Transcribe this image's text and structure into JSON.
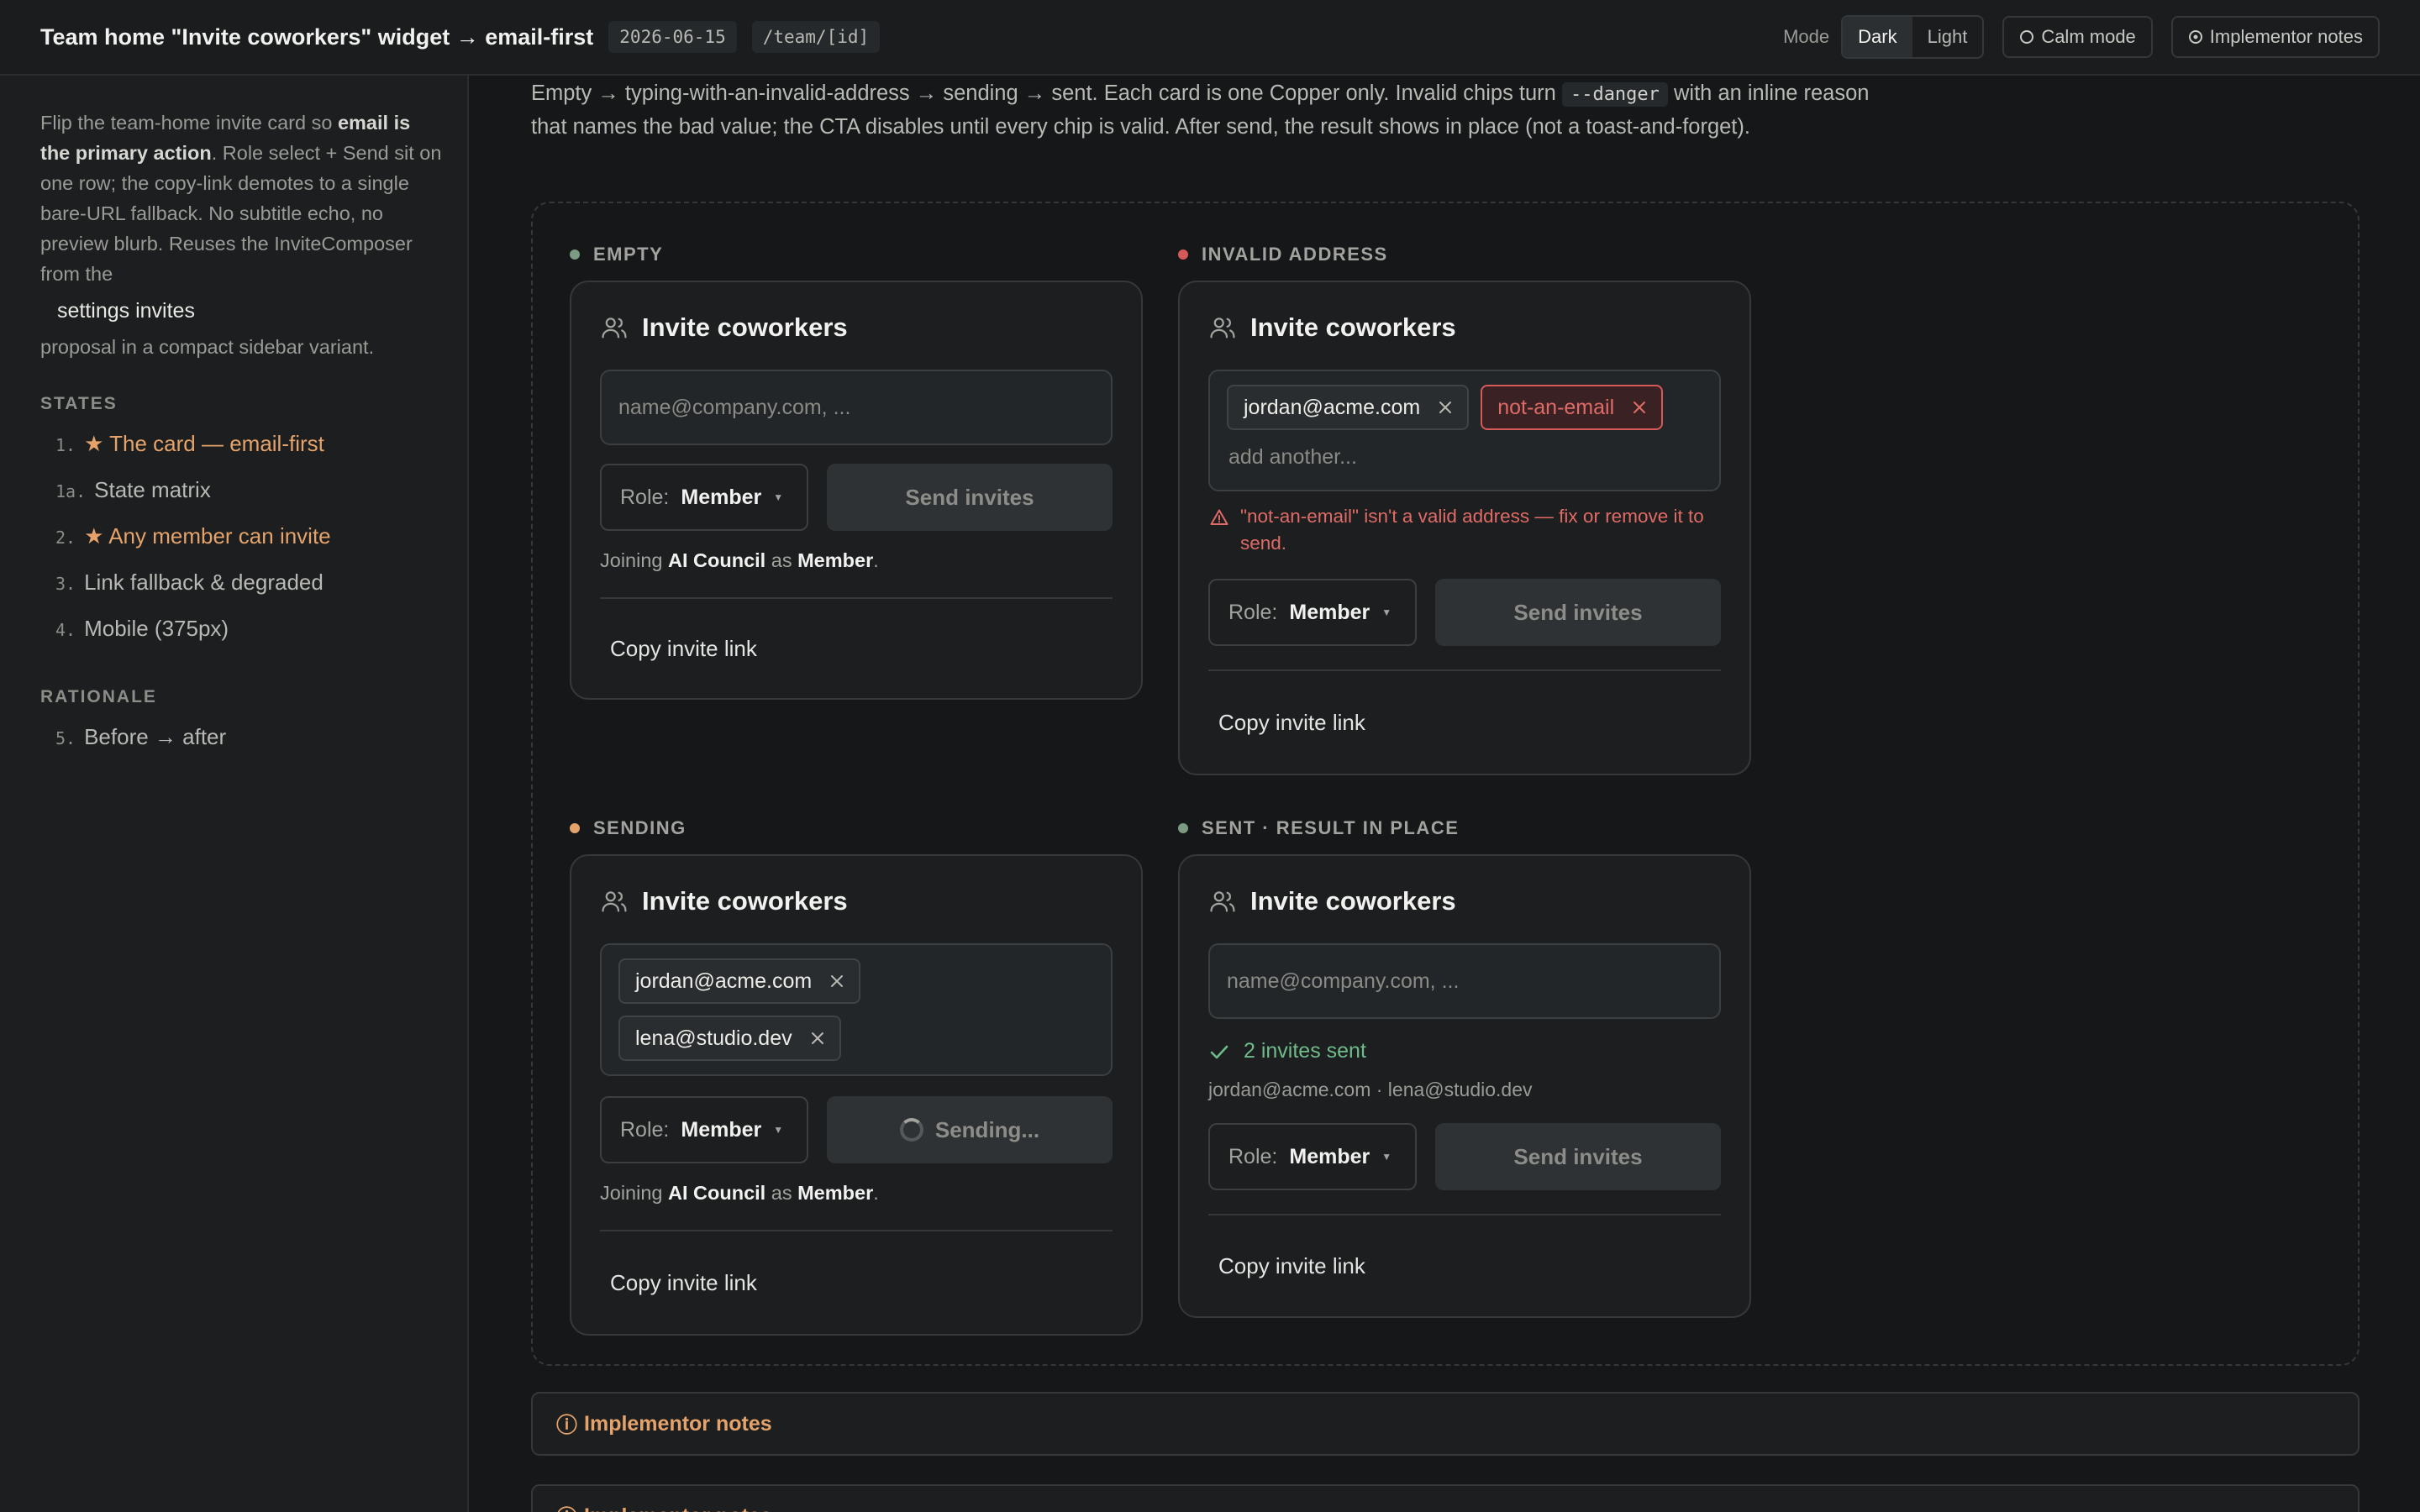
{
  "topbar": {
    "title": "Team home \"Invite coworkers\" widget → email-first",
    "date": "2026-06-15",
    "route": "/team/[id]",
    "mode_label": "Mode",
    "mode_options": [
      "Dark",
      "Light"
    ],
    "mode_selected": "Dark",
    "calm_mode": "Calm mode",
    "implementor_notes": "Implementor notes"
  },
  "sidebar": {
    "desc_part1": "Flip the team-home invite card so ",
    "desc_bold": "email is the primary action",
    "desc_part2": ". Role select + Send sit on one row; the copy-link demotes to a single bare-URL fallback. No subtitle echo, no preview blurb. Reuses the InviteComposer from the",
    "desc_link": "settings invites",
    "desc_part3": "proposal in a compact sidebar variant.",
    "states_heading": "STATES",
    "states": [
      {
        "num": "1.",
        "label": "★ The card — email-first",
        "star": true
      },
      {
        "num": "1a.",
        "label": "State matrix",
        "star": false
      },
      {
        "num": "2.",
        "label": "★ Any member can invite",
        "star": true
      },
      {
        "num": "3.",
        "label": "Link fallback & degraded",
        "star": false
      },
      {
        "num": "4.",
        "label": "Mobile (375px)",
        "star": false
      }
    ],
    "rationale_heading": "RATIONALE",
    "rationale": [
      {
        "num": "5.",
        "label": "Before → after"
      }
    ]
  },
  "intro": {
    "part1": "Empty → typing-with-an-invalid-address → sending → sent. Each card is one Copper only. Invalid chips turn ",
    "code": "--danger",
    "part2": " with an inline reason that names the bad value; the CTA disables until every chip is valid. After send, the result shows in place (not a toast-and-forget)."
  },
  "common": {
    "card_title": "Invite coworkers",
    "placeholder": "name@company.com, ...",
    "role_label": "Role:",
    "role_value": "Member",
    "send_label": "Send invites",
    "copy_link": "Copy invite link",
    "joining_pre": "Joining",
    "team": "AI Council",
    "joining_as": "as",
    "joining_end": "."
  },
  "states": {
    "empty": {
      "label": "EMPTY",
      "dot": "#7d9a83"
    },
    "invalid": {
      "label": "INVALID ADDRESS",
      "dot": "#d65a5a",
      "chip_valid": "jordan@acme.com",
      "chip_invalid": "not-an-email",
      "add_another": "add another...",
      "error": "\"not-an-email\" isn't a valid address — fix or remove it to send."
    },
    "sending": {
      "label": "SENDING",
      "dot": "#e5a36b",
      "chips": [
        "jordan@acme.com",
        "lena@studio.dev"
      ],
      "send_label": "Sending..."
    },
    "sent": {
      "label": "SENT · RESULT IN PLACE",
      "dot": "#7d9a83",
      "result": "2 invites sent",
      "recipients": "jordan@acme.com · lena@studio.dev"
    }
  },
  "notes": [
    "Implementor notes",
    "Implementor notes"
  ],
  "colors": {
    "accent": "#e5a36b",
    "danger": "#d65a5a",
    "success": "#6fbb8a",
    "background": "#151718"
  }
}
